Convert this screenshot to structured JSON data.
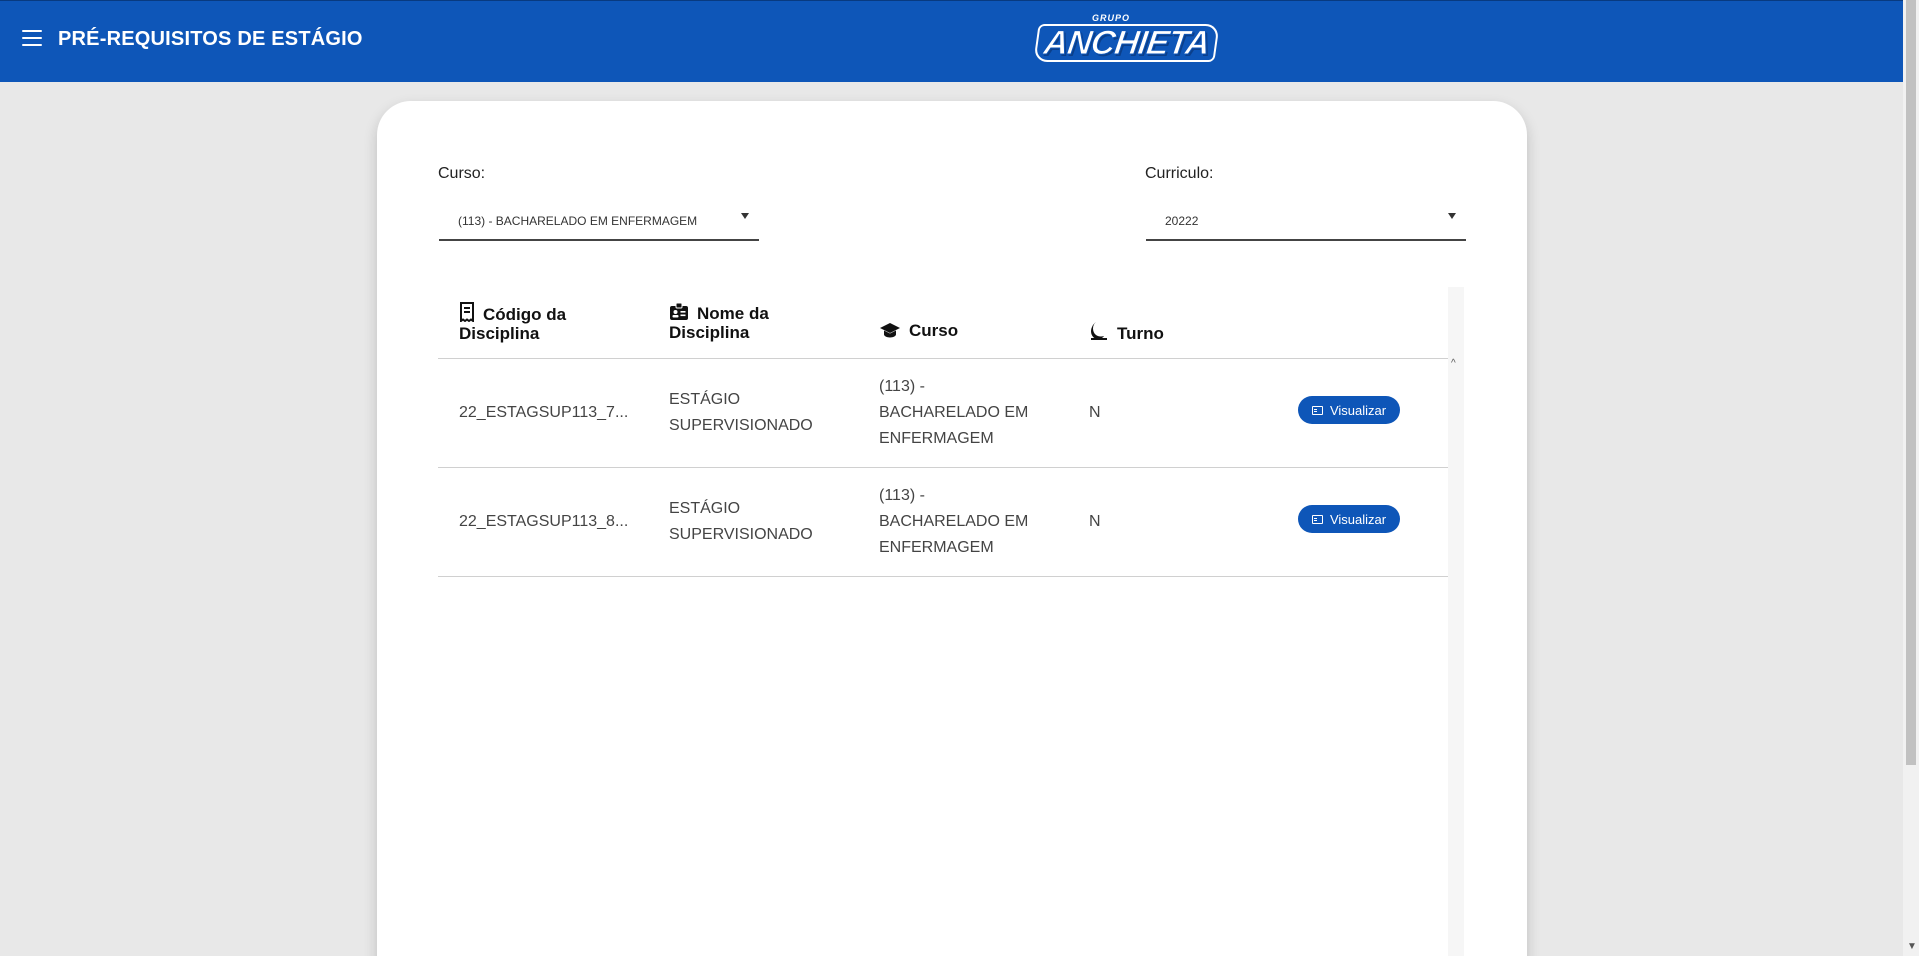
{
  "header": {
    "title": "PRÉ-REQUISITOS DE ESTÁGIO",
    "logo_small": "GRUPO",
    "logo_big": "ANCHIETA",
    "color": "#0e56b8"
  },
  "filters": {
    "curso_label": "Curso:",
    "curso_value": "(113) - BACHARELADO EM ENFERMAGEM",
    "curriculo_label": "Curriculo:",
    "curriculo_value": "20222"
  },
  "table": {
    "columns": [
      {
        "label": "Código da Disciplina",
        "icon": "receipt-icon"
      },
      {
        "label": "Nome da Disciplina",
        "icon": "id-card-icon"
      },
      {
        "label": "Curso",
        "icon": "graduation-cap-icon"
      },
      {
        "label": "Turno",
        "icon": "moon-icon"
      }
    ],
    "col0_line1": "Código da",
    "col0_line2": "Disciplina",
    "col1_line1": "Nome da",
    "col1_line2": "Disciplina",
    "col2": "Curso",
    "col3": "Turno",
    "rows": [
      {
        "codigo": "22_ESTAGSUP113_7...",
        "nome_line1": "ESTÁGIO",
        "nome_line2": "SUPERVISIONADO",
        "curso_line1": "(113) -",
        "curso_line2": "BACHARELADO EM",
        "curso_line3": "ENFERMAGEM",
        "turno": "N",
        "action": "Visualizar"
      },
      {
        "codigo": "22_ESTAGSUP113_8...",
        "nome_line1": "ESTÁGIO",
        "nome_line2": "SUPERVISIONADO",
        "curso_line1": "(113) -",
        "curso_line2": "BACHARELADO EM",
        "curso_line3": "ENFERMAGEM",
        "turno": "N",
        "action": "Visualizar"
      }
    ]
  }
}
